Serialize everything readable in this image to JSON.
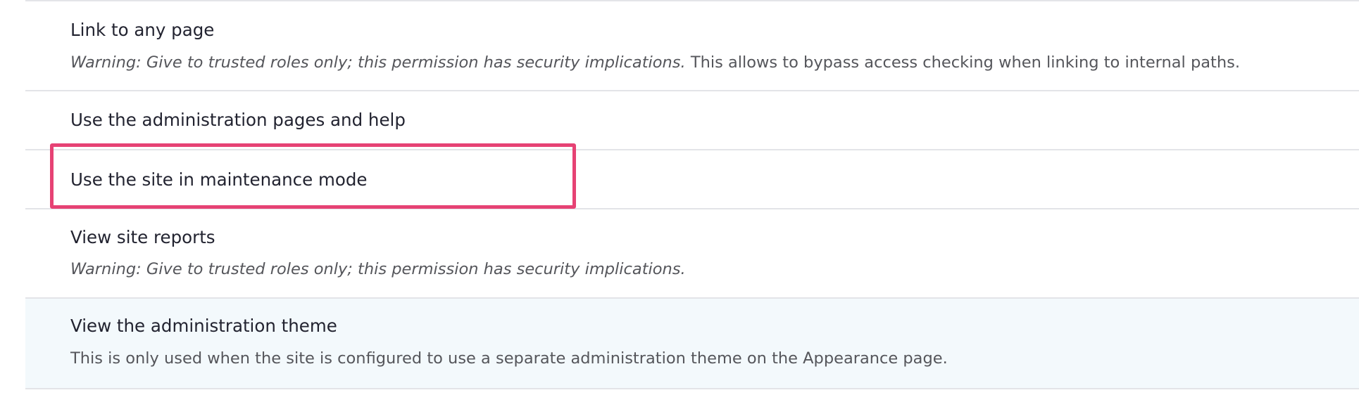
{
  "permissions": [
    {
      "title": "Link to any page",
      "warning": "Warning: Give to trusted roles only; this permission has security implications.",
      "description": "This allows to bypass access checking when linking to internal paths."
    },
    {
      "title": "Use the administration pages and help"
    },
    {
      "title": "Use the site in maintenance mode"
    },
    {
      "title": "View site reports",
      "warning": "Warning: Give to trusted roles only; this permission has security implications."
    },
    {
      "title": "View the administration theme",
      "description": "This is only used when the site is configured to use a separate administration theme on the Appearance page."
    }
  ],
  "colors": {
    "highlight_border": "#e64274",
    "row_hover_bg": "#f3f9fc",
    "divider": "#e3e4e8"
  }
}
